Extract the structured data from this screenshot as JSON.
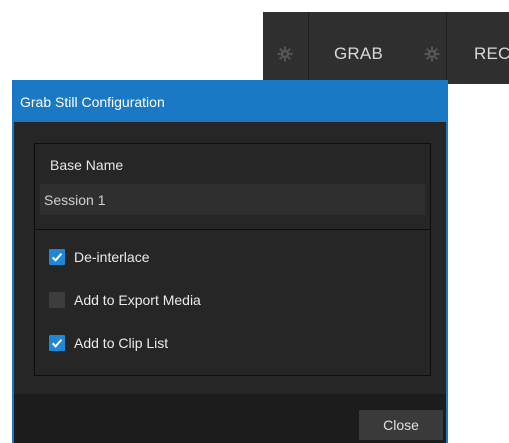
{
  "toolbar": {
    "grab_label": "GRAB",
    "rec_label": "REC",
    "gear_icon": "gear-icon"
  },
  "dialog": {
    "title": "Grab Still Configuration",
    "base_name": {
      "label": "Base Name",
      "value": "Session 1"
    },
    "options": [
      {
        "label": "De-interlace",
        "checked": true
      },
      {
        "label": "Add to Export Media",
        "checked": false
      },
      {
        "label": "Add to Clip List",
        "checked": true
      }
    ],
    "close_label": "Close"
  },
  "colors": {
    "accent": "#1b78c4",
    "checkbox_checked": "#1f87d8",
    "background": "#262626"
  }
}
